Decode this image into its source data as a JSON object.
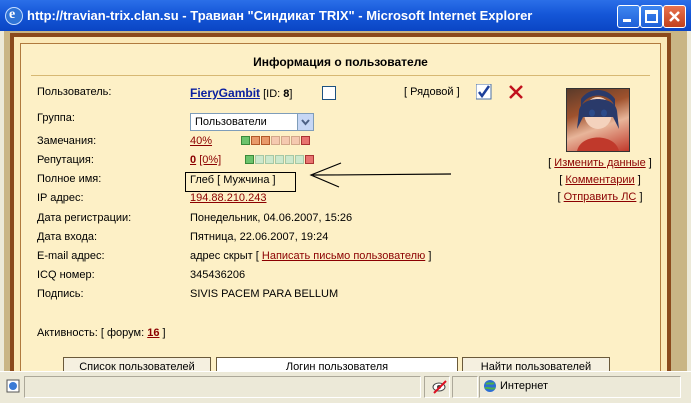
{
  "window": {
    "title": "http://travian-trix.clan.su - Травиан \"Синдикат TRIX\" - Microsoft Internet Explorer"
  },
  "panel": {
    "header": "Информация о пользователе"
  },
  "user": {
    "label_user": "Пользователь:",
    "name": "FieryGambit",
    "id_open": "[ID:",
    "id_value": "8",
    "id_close": "]",
    "rank": "[ Рядовой ]",
    "label_group": "Группа:",
    "group_value": "Пользователи",
    "label_remarks": "Замечания:",
    "remarks_value": "40%",
    "label_reputation": "Репутация:",
    "reputation_value": "0",
    "reputation_percent": "[0%]",
    "label_fullname": "Полное имя:",
    "fullname_value": "Глеб [ Мужчина ]",
    "label_ip": "IP адрес:",
    "ip_value": "194.88.210.243",
    "label_regdate": "Дата регистрации:",
    "regdate_value": "Понедельник, 04.06.2007, 15:26",
    "label_logindate": "Дата входа:",
    "logindate_value": "Пятница, 22.06.2007, 19:24",
    "label_email": "E-mail адрес:",
    "email_value": "адрес скрыт",
    "email_link_open": "[",
    "email_link": "Написать письмо пользователю",
    "email_link_close": "]",
    "label_icq": "ICQ номер:",
    "icq_value": "345436206",
    "label_signature": "Подпись:",
    "signature_value": "SIVIS PACEM PARA BELLUM",
    "activity_prefix": "Активность: [ форум:",
    "activity_value": "16",
    "activity_suffix": "]"
  },
  "side_links": {
    "edit": "Изменить данные",
    "comments": "Комментарии",
    "send_pm": "Отправить ЛС",
    "open": "[",
    "close": "]"
  },
  "bottom_buttons": {
    "users_list": "Список пользователей",
    "users_login": "Логин пользователя",
    "find_users": "Найти пользователей"
  },
  "statusbar": {
    "zone": "Интернет"
  },
  "colors": {
    "titlebar": "#0a45c4",
    "panel_bg": "#fdf0c6",
    "frame": "#8b4a1c",
    "link": "#8b0000",
    "username": "#0a1fa0"
  }
}
